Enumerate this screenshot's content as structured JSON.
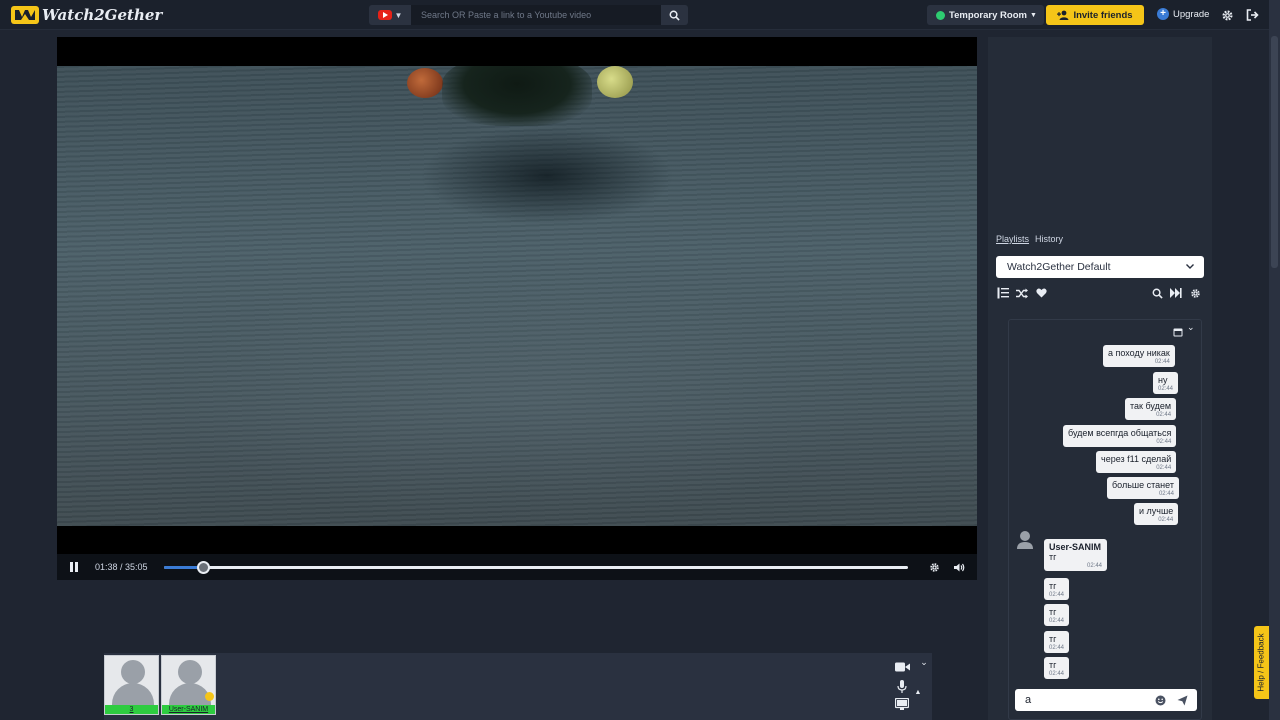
{
  "app": {
    "name": "Watch2Gether"
  },
  "search": {
    "placeholder": "Search OR Paste a link to a Youtube video"
  },
  "room": {
    "label": "Temporary Room"
  },
  "invite": {
    "label": "Invite friends"
  },
  "upgrade": {
    "label": "Upgrade"
  },
  "player": {
    "time": "01:38 / 35:05",
    "progress": 0.053
  },
  "users": [
    {
      "name": "3"
    },
    {
      "name": "User-SANIM"
    }
  ],
  "sidebar": {
    "tabs": [
      "Playlists",
      "History"
    ],
    "playlist_selected": "Watch2Gether Default"
  },
  "chat": {
    "messages": [
      {
        "text": "а походу никак",
        "time": "02:44"
      },
      {
        "text": "ну",
        "time": "02:44"
      },
      {
        "text": "так будем",
        "time": "02:44"
      },
      {
        "text": "будем всепгда общаться",
        "time": "02:44"
      },
      {
        "text": "через f11 сделай",
        "time": "02:44"
      },
      {
        "text": "больше станет",
        "time": "02:44"
      },
      {
        "text": "и лучше",
        "time": "02:44"
      },
      {
        "user": "User-SANIM",
        "text": "тг",
        "time": "02:44"
      },
      {
        "text": "тг",
        "time": "02:44"
      },
      {
        "text": "тг",
        "time": "02:44"
      },
      {
        "text": "тг",
        "time": "02:44"
      },
      {
        "text": "тг",
        "time": "02:44"
      }
    ],
    "input_value": "а"
  },
  "feedback": {
    "label": "Help / Feedback"
  },
  "colors": {
    "accent": "#f5c518",
    "progress": "#3a7bd5",
    "online": "#2ecc40"
  }
}
